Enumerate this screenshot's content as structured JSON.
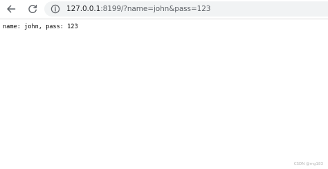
{
  "browser": {
    "address_host": "127.0.0.1",
    "address_rest": ":8199/?name=john&pass=123",
    "icons": {
      "back": "arrow-left-icon",
      "reload": "reload-icon",
      "site_info": "info-circle-icon"
    }
  },
  "page": {
    "body_text": "name: john, pass: 123"
  },
  "watermark": {
    "text": "CSDN @mg183"
  },
  "colors": {
    "address_bar_bg": "#f1f3f4",
    "icon": "#5f6368",
    "text": "#000000"
  }
}
